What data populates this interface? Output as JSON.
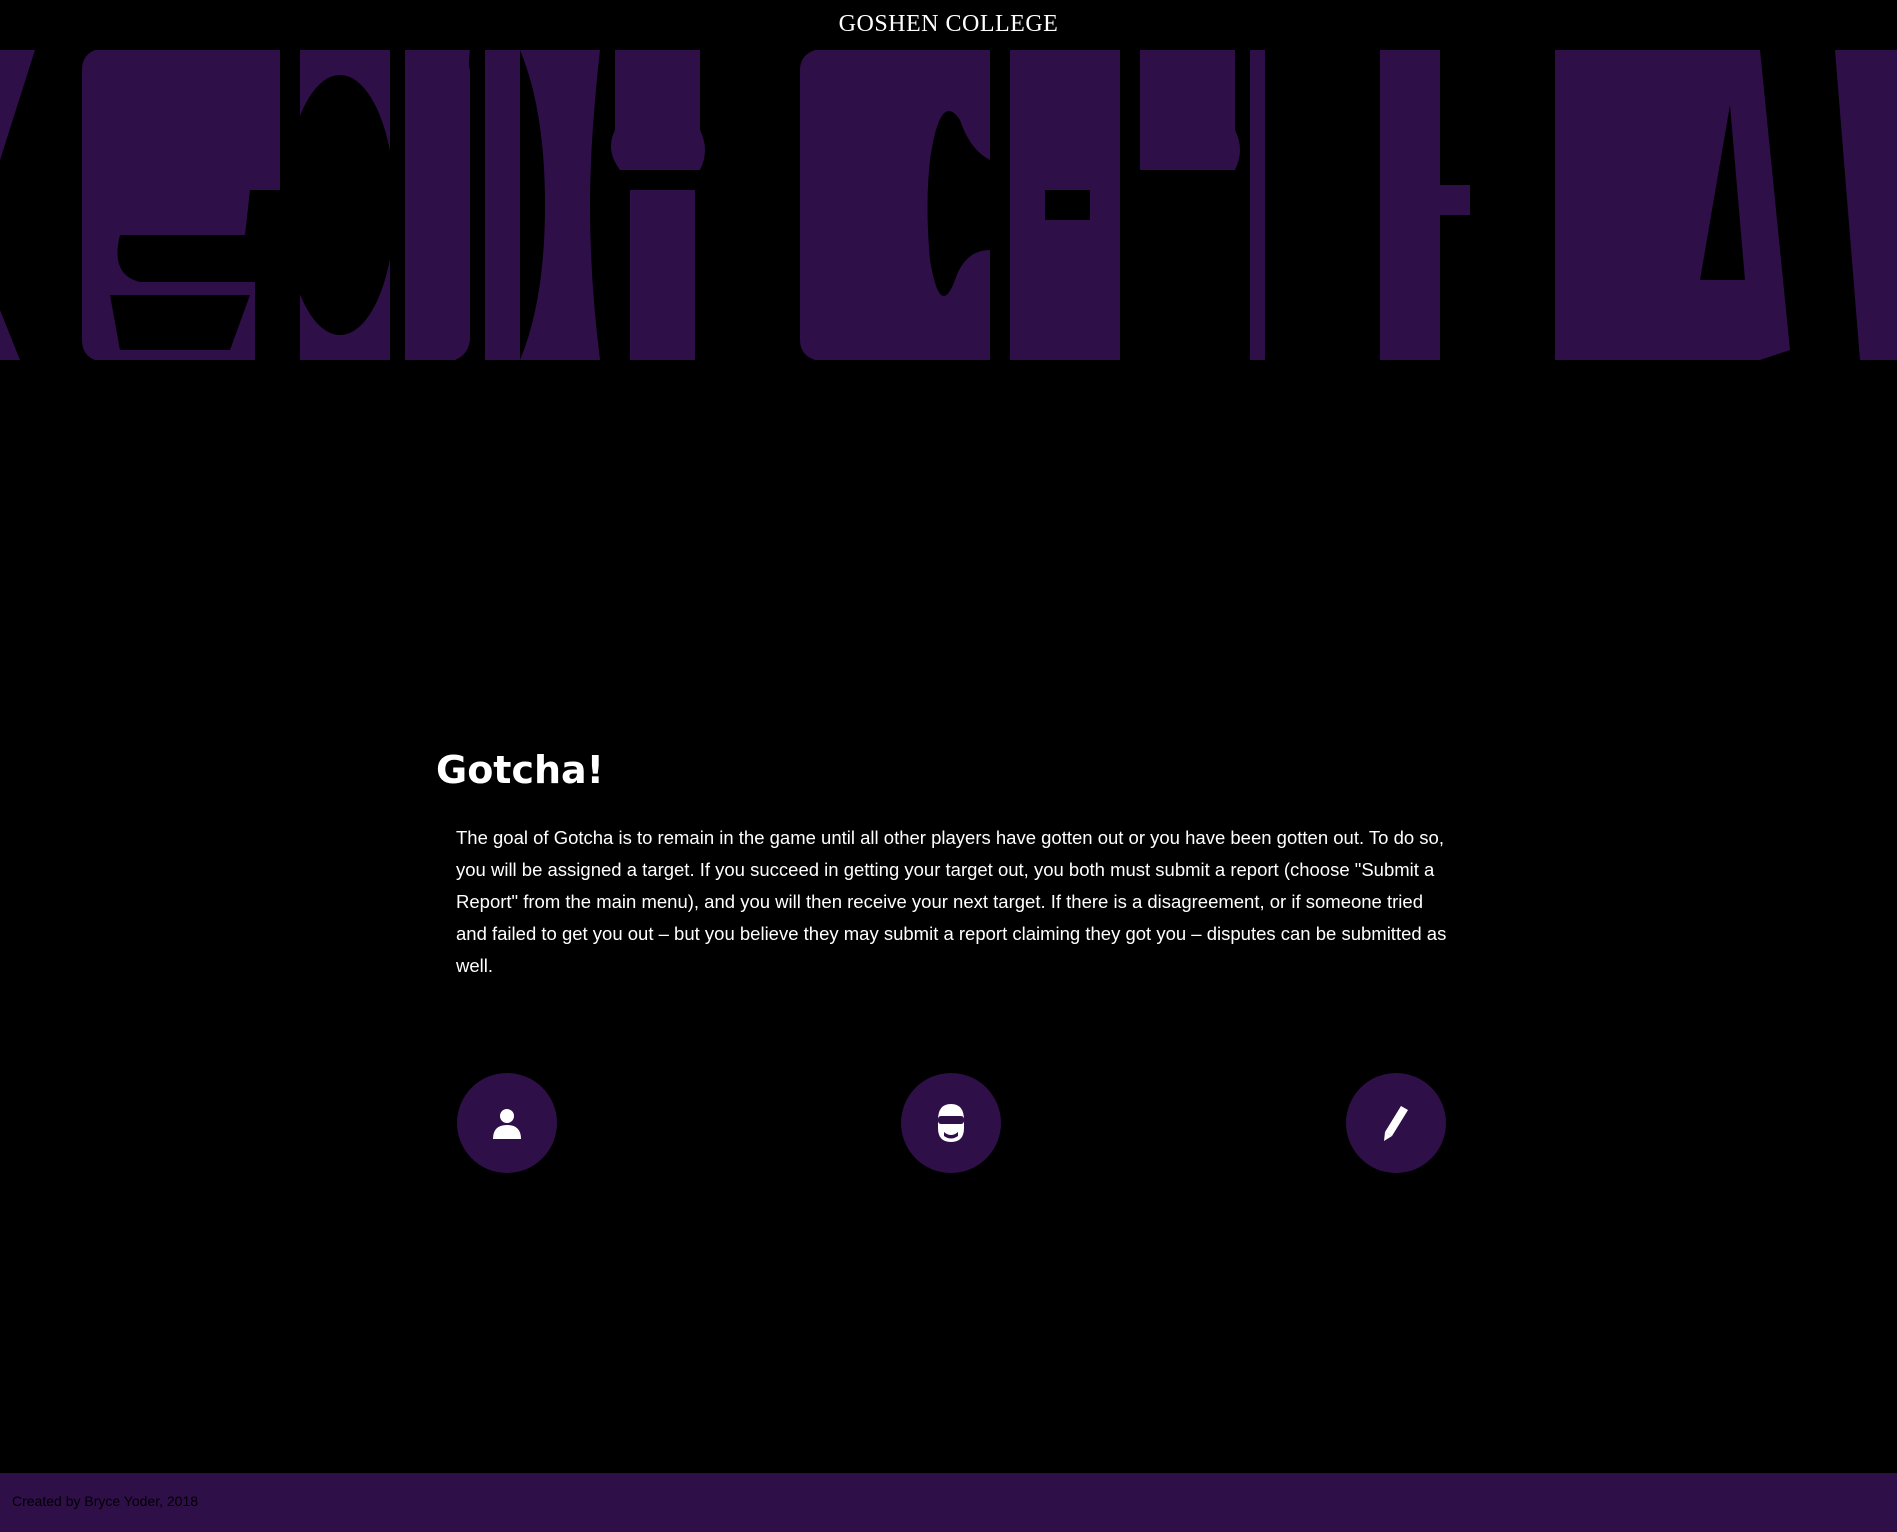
{
  "header": {
    "college_name": "GOSHEN COLLEGE"
  },
  "hero": {
    "banner_text": "GOTCHA"
  },
  "intro": {
    "title": "Gotcha!",
    "description": "The goal of Gotcha is to remain in the game until all other players have gotten out or you have been gotten out. To do so, you will be assigned a target. If you succeed in getting your target out, you both must submit a report (choose \"Submit a Report\" from the main menu), and you will then receive your next target. If there is a disagreement, or if someone tried and failed to get you out – but you believe they may submit a report claiming they got you – disputes can be submitted as well."
  },
  "actions": [
    {
      "icon": "person-icon"
    },
    {
      "icon": "masked-face-icon"
    },
    {
      "icon": "pencil-icon"
    }
  ],
  "footer": {
    "credit": "Created by Bryce Yoder, 2018"
  },
  "colors": {
    "background": "#000000",
    "brand_purple": "#2e0f48",
    "text": "#ffffff"
  }
}
